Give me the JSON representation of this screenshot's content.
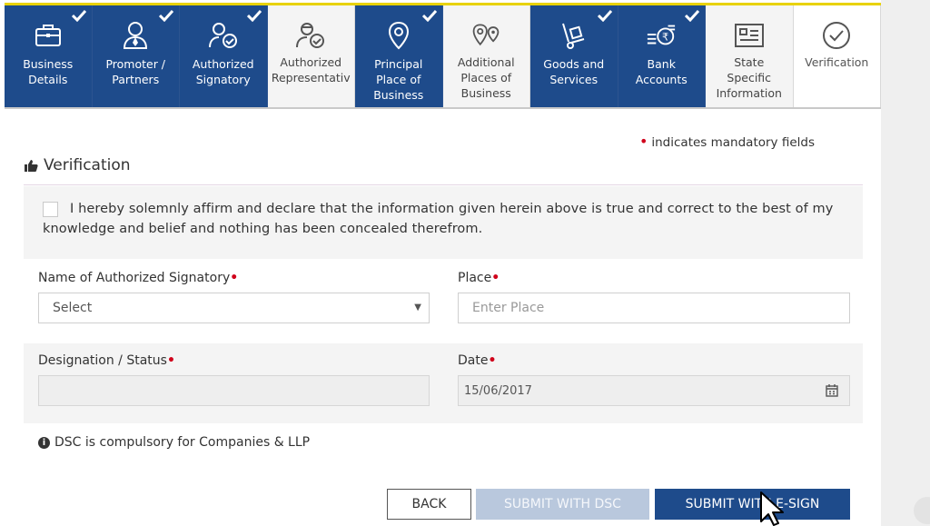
{
  "tabs": [
    {
      "label": "Business\nDetails",
      "state": "done"
    },
    {
      "label": "Promoter /\nPartners",
      "state": "done"
    },
    {
      "label": "Authorized\nSignatory",
      "state": "done"
    },
    {
      "label": "Authorized\nRepresentativ",
      "state": "light"
    },
    {
      "label": "Principal\nPlace of\nBusiness",
      "state": "done"
    },
    {
      "label": "Additional\nPlaces of\nBusiness",
      "state": "light"
    },
    {
      "label": "Goods and\nServices",
      "state": "done"
    },
    {
      "label": "Bank\nAccounts",
      "state": "done"
    },
    {
      "label": "State\nSpecific\nInformation",
      "state": "light"
    },
    {
      "label": "Verification",
      "state": "current"
    }
  ],
  "mandatory_note": "indicates mandatory fields",
  "mandatory_marker": "•",
  "section_title": "Verification",
  "declaration": "I hereby solemnly affirm and declare that the information given herein above is true and correct to the best of my knowledge and belief and nothing has been concealed therefrom.",
  "form": {
    "signatory_label": "Name of Authorized Signatory",
    "signatory_value": "Select",
    "place_label": "Place",
    "place_placeholder": "Enter Place",
    "designation_label": "Designation / Status",
    "designation_value": "",
    "date_label": "Date",
    "date_value": "15/06/2017",
    "required_marker": "•"
  },
  "dsc_note": "DSC is compulsory for Companies & LLP",
  "buttons": {
    "back": "BACK",
    "submit_dsc": "SUBMIT WITH DSC",
    "submit_esign": "SUBMIT WITH E-SIGN"
  },
  "colors": {
    "primary": "#1e4b8b",
    "required": "#d0021b",
    "accent_bar": "#e8d200"
  }
}
